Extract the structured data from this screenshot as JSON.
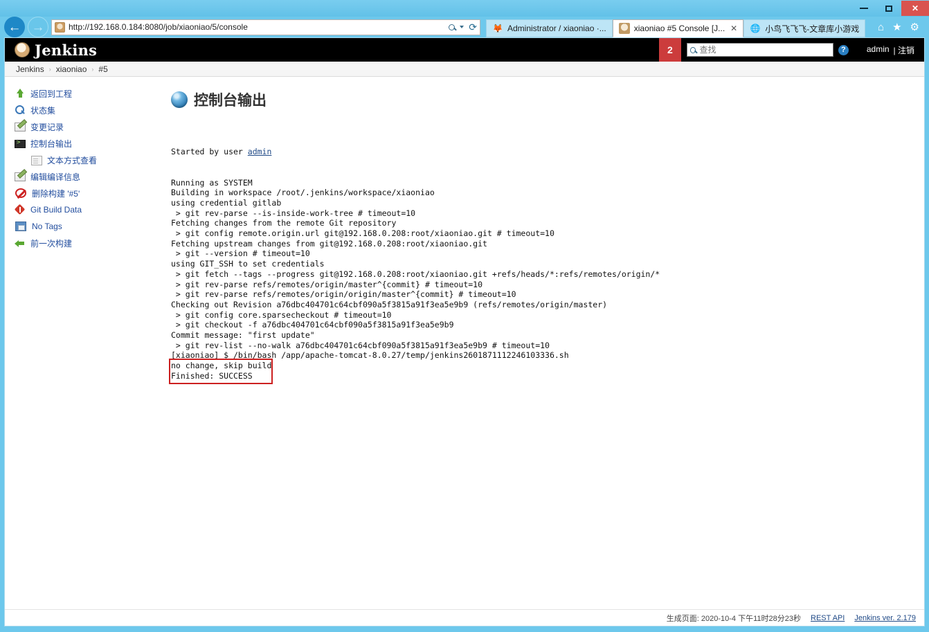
{
  "window": {
    "minimize_label": "minimize",
    "maximize_label": "maximize",
    "close_label": "✕"
  },
  "browser": {
    "url": "http://192.168.0.184:8080/job/xiaoniao/5/console",
    "url_parts": {
      "scheme": "http://",
      "host": "192.168.0.184",
      "rest": ":8080/job/xiaoniao/5/console"
    },
    "back_glyph": "←",
    "forward_glyph": "→",
    "reload_glyph": "⟳",
    "tabs": [
      {
        "label": "Administrator / xiaoniao ·...",
        "active": false,
        "favicon": "firefox-icon"
      },
      {
        "label": "xiaoniao #5 Console [J...",
        "active": true,
        "favicon": "jenkins-icon",
        "close": "✕"
      },
      {
        "label": "小鸟飞飞飞-文章库小游戏",
        "active": false,
        "favicon": "ie-icon"
      }
    ],
    "toolbar_icons": [
      {
        "name": "home-icon",
        "glyph": "⌂"
      },
      {
        "name": "favorites-icon",
        "glyph": "★"
      },
      {
        "name": "settings-gear-icon",
        "glyph": "⚙"
      }
    ]
  },
  "header": {
    "title": "Jenkins",
    "build_badge": "2",
    "search_placeholder": "查找",
    "search_value": "",
    "help_glyph": "?",
    "user": "admin",
    "logout": "| 注销"
  },
  "breadcrumb": {
    "items": [
      "Jenkins",
      "xiaoniao",
      "#5"
    ],
    "separator": "›"
  },
  "sidebar": {
    "items": [
      {
        "label": "返回到工程",
        "icon": "up-arrow-icon"
      },
      {
        "label": "状态集",
        "icon": "search-icon"
      },
      {
        "label": "变更记录",
        "icon": "edit-icon"
      },
      {
        "label": "控制台输出",
        "icon": "terminal-icon"
      },
      {
        "label": "文本方式查看",
        "icon": "document-icon",
        "sub": true
      },
      {
        "label": "编辑编译信息",
        "icon": "edit-icon"
      },
      {
        "label": "删除构建 '#5'",
        "icon": "deny-icon"
      },
      {
        "label": "Git Build Data",
        "icon": "git-diamond-icon"
      },
      {
        "label": "No Tags",
        "icon": "floppy-icon"
      },
      {
        "label": "前一次构建",
        "icon": "left-arrow-icon"
      }
    ]
  },
  "main": {
    "title": "控制台输出",
    "title_icon": "blue-ball-icon",
    "console": {
      "started_by_prefix": "Started by user ",
      "started_by_link": "admin",
      "lines": [
        "Running as SYSTEM",
        "Building in workspace /root/.jenkins/workspace/xiaoniao",
        "using credential gitlab",
        " > git rev-parse --is-inside-work-tree # timeout=10",
        "Fetching changes from the remote Git repository",
        " > git config remote.origin.url git@192.168.0.208:root/xiaoniao.git # timeout=10",
        "Fetching upstream changes from git@192.168.0.208:root/xiaoniao.git",
        " > git --version # timeout=10",
        "using GIT_SSH to set credentials",
        " > git fetch --tags --progress git@192.168.0.208:root/xiaoniao.git +refs/heads/*:refs/remotes/origin/*",
        " > git rev-parse refs/remotes/origin/master^{commit} # timeout=10",
        " > git rev-parse refs/remotes/origin/origin/master^{commit} # timeout=10",
        "Checking out Revision a76dbc404701c64cbf090a5f3815a91f3ea5e9b9 (refs/remotes/origin/master)",
        " > git config core.sparsecheckout # timeout=10",
        " > git checkout -f a76dbc404701c64cbf090a5f3815a91f3ea5e9b9",
        "Commit message: \"first update\"",
        " > git rev-list --no-walk a76dbc404701c64cbf090a5f3815a91f3ea5e9b9 # timeout=10",
        "[xiaoniao] $ /bin/bash /app/apache-tomcat-8.0.27/temp/jenkins2601871112246103336.sh",
        "no change, skip build",
        "Finished: SUCCESS"
      ],
      "highlight": {
        "first_line_index": 18,
        "last_line_index": 19,
        "color": "#cc2020"
      }
    }
  },
  "footer": {
    "generated": "生成页面: 2020-10-4 下午11时28分23秒",
    "rest_api": "REST API",
    "version": "Jenkins ver. 2.179"
  },
  "colors": {
    "chrome_blue": "#6dc8ec",
    "jenkins_black": "#000000",
    "badge_red": "#cc3c3c",
    "link_blue": "#204a87",
    "highlight_red": "#cc2020"
  }
}
